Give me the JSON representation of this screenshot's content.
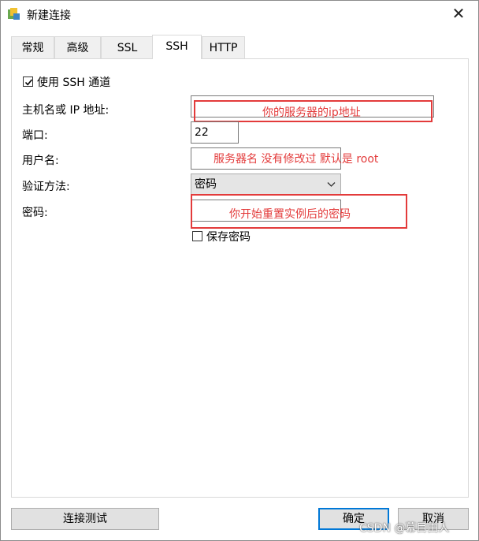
{
  "window": {
    "title": "新建连接",
    "close_glyph": "✕"
  },
  "tabs": [
    {
      "label": "常规",
      "active": false
    },
    {
      "label": "高级",
      "active": false
    },
    {
      "label": "SSL",
      "active": false
    },
    {
      "label": "SSH",
      "active": true
    },
    {
      "label": "HTTP",
      "active": false
    }
  ],
  "ssh": {
    "use_ssh_label": "使用 SSH 通道",
    "use_ssh_checked": true,
    "host_label": "主机名或 IP 地址:",
    "host_value": "",
    "port_label": "端口:",
    "port_value": "22",
    "user_label": "用户名:",
    "user_value": "",
    "auth_label": "验证方法:",
    "auth_value": "密码",
    "password_label": "密码:",
    "password_value": "",
    "save_password_label": "保存密码",
    "save_password_checked": false
  },
  "annotations": {
    "host": "你的服务器的ip地址",
    "user": "服务器名 没有修改过 默认是 root",
    "password": "你开始重置实例后的密码"
  },
  "buttons": {
    "test": "连接测试",
    "ok": "确定",
    "cancel": "取消"
  },
  "watermark": "CSDN @幕目由人",
  "colors": {
    "annotation": "#e33b3b",
    "focus": "#0078d7"
  }
}
